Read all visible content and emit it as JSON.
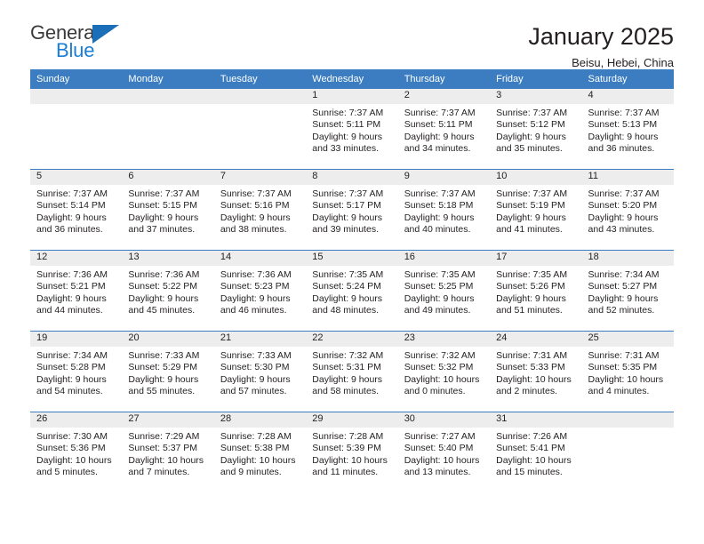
{
  "brand": {
    "name_part1": "General",
    "name_part2": "Blue",
    "triangle_icon": "triangle-icon",
    "primary_color": "#1a7fd4",
    "header_color": "#3b7dc0"
  },
  "header": {
    "title": "January 2025",
    "subtitle": "Beisu, Hebei, China"
  },
  "calendar": {
    "weekday_headers": [
      "Sunday",
      "Monday",
      "Tuesday",
      "Wednesday",
      "Thursday",
      "Friday",
      "Saturday"
    ],
    "weeks": [
      [
        {
          "day": "",
          "empty": true
        },
        {
          "day": "",
          "empty": true
        },
        {
          "day": "",
          "empty": true
        },
        {
          "day": "1",
          "sunrise": "Sunrise: 7:37 AM",
          "sunset": "Sunset: 5:11 PM",
          "daylight_line1": "Daylight: 9 hours",
          "daylight_line2": "and 33 minutes."
        },
        {
          "day": "2",
          "sunrise": "Sunrise: 7:37 AM",
          "sunset": "Sunset: 5:11 PM",
          "daylight_line1": "Daylight: 9 hours",
          "daylight_line2": "and 34 minutes."
        },
        {
          "day": "3",
          "sunrise": "Sunrise: 7:37 AM",
          "sunset": "Sunset: 5:12 PM",
          "daylight_line1": "Daylight: 9 hours",
          "daylight_line2": "and 35 minutes."
        },
        {
          "day": "4",
          "sunrise": "Sunrise: 7:37 AM",
          "sunset": "Sunset: 5:13 PM",
          "daylight_line1": "Daylight: 9 hours",
          "daylight_line2": "and 36 minutes."
        }
      ],
      [
        {
          "day": "5",
          "sunrise": "Sunrise: 7:37 AM",
          "sunset": "Sunset: 5:14 PM",
          "daylight_line1": "Daylight: 9 hours",
          "daylight_line2": "and 36 minutes."
        },
        {
          "day": "6",
          "sunrise": "Sunrise: 7:37 AM",
          "sunset": "Sunset: 5:15 PM",
          "daylight_line1": "Daylight: 9 hours",
          "daylight_line2": "and 37 minutes."
        },
        {
          "day": "7",
          "sunrise": "Sunrise: 7:37 AM",
          "sunset": "Sunset: 5:16 PM",
          "daylight_line1": "Daylight: 9 hours",
          "daylight_line2": "and 38 minutes."
        },
        {
          "day": "8",
          "sunrise": "Sunrise: 7:37 AM",
          "sunset": "Sunset: 5:17 PM",
          "daylight_line1": "Daylight: 9 hours",
          "daylight_line2": "and 39 minutes."
        },
        {
          "day": "9",
          "sunrise": "Sunrise: 7:37 AM",
          "sunset": "Sunset: 5:18 PM",
          "daylight_line1": "Daylight: 9 hours",
          "daylight_line2": "and 40 minutes."
        },
        {
          "day": "10",
          "sunrise": "Sunrise: 7:37 AM",
          "sunset": "Sunset: 5:19 PM",
          "daylight_line1": "Daylight: 9 hours",
          "daylight_line2": "and 41 minutes."
        },
        {
          "day": "11",
          "sunrise": "Sunrise: 7:37 AM",
          "sunset": "Sunset: 5:20 PM",
          "daylight_line1": "Daylight: 9 hours",
          "daylight_line2": "and 43 minutes."
        }
      ],
      [
        {
          "day": "12",
          "sunrise": "Sunrise: 7:36 AM",
          "sunset": "Sunset: 5:21 PM",
          "daylight_line1": "Daylight: 9 hours",
          "daylight_line2": "and 44 minutes."
        },
        {
          "day": "13",
          "sunrise": "Sunrise: 7:36 AM",
          "sunset": "Sunset: 5:22 PM",
          "daylight_line1": "Daylight: 9 hours",
          "daylight_line2": "and 45 minutes."
        },
        {
          "day": "14",
          "sunrise": "Sunrise: 7:36 AM",
          "sunset": "Sunset: 5:23 PM",
          "daylight_line1": "Daylight: 9 hours",
          "daylight_line2": "and 46 minutes."
        },
        {
          "day": "15",
          "sunrise": "Sunrise: 7:35 AM",
          "sunset": "Sunset: 5:24 PM",
          "daylight_line1": "Daylight: 9 hours",
          "daylight_line2": "and 48 minutes."
        },
        {
          "day": "16",
          "sunrise": "Sunrise: 7:35 AM",
          "sunset": "Sunset: 5:25 PM",
          "daylight_line1": "Daylight: 9 hours",
          "daylight_line2": "and 49 minutes."
        },
        {
          "day": "17",
          "sunrise": "Sunrise: 7:35 AM",
          "sunset": "Sunset: 5:26 PM",
          "daylight_line1": "Daylight: 9 hours",
          "daylight_line2": "and 51 minutes."
        },
        {
          "day": "18",
          "sunrise": "Sunrise: 7:34 AM",
          "sunset": "Sunset: 5:27 PM",
          "daylight_line1": "Daylight: 9 hours",
          "daylight_line2": "and 52 minutes."
        }
      ],
      [
        {
          "day": "19",
          "sunrise": "Sunrise: 7:34 AM",
          "sunset": "Sunset: 5:28 PM",
          "daylight_line1": "Daylight: 9 hours",
          "daylight_line2": "and 54 minutes."
        },
        {
          "day": "20",
          "sunrise": "Sunrise: 7:33 AM",
          "sunset": "Sunset: 5:29 PM",
          "daylight_line1": "Daylight: 9 hours",
          "daylight_line2": "and 55 minutes."
        },
        {
          "day": "21",
          "sunrise": "Sunrise: 7:33 AM",
          "sunset": "Sunset: 5:30 PM",
          "daylight_line1": "Daylight: 9 hours",
          "daylight_line2": "and 57 minutes."
        },
        {
          "day": "22",
          "sunrise": "Sunrise: 7:32 AM",
          "sunset": "Sunset: 5:31 PM",
          "daylight_line1": "Daylight: 9 hours",
          "daylight_line2": "and 58 minutes."
        },
        {
          "day": "23",
          "sunrise": "Sunrise: 7:32 AM",
          "sunset": "Sunset: 5:32 PM",
          "daylight_line1": "Daylight: 10 hours",
          "daylight_line2": "and 0 minutes."
        },
        {
          "day": "24",
          "sunrise": "Sunrise: 7:31 AM",
          "sunset": "Sunset: 5:33 PM",
          "daylight_line1": "Daylight: 10 hours",
          "daylight_line2": "and 2 minutes."
        },
        {
          "day": "25",
          "sunrise": "Sunrise: 7:31 AM",
          "sunset": "Sunset: 5:35 PM",
          "daylight_line1": "Daylight: 10 hours",
          "daylight_line2": "and 4 minutes."
        }
      ],
      [
        {
          "day": "26",
          "sunrise": "Sunrise: 7:30 AM",
          "sunset": "Sunset: 5:36 PM",
          "daylight_line1": "Daylight: 10 hours",
          "daylight_line2": "and 5 minutes."
        },
        {
          "day": "27",
          "sunrise": "Sunrise: 7:29 AM",
          "sunset": "Sunset: 5:37 PM",
          "daylight_line1": "Daylight: 10 hours",
          "daylight_line2": "and 7 minutes."
        },
        {
          "day": "28",
          "sunrise": "Sunrise: 7:28 AM",
          "sunset": "Sunset: 5:38 PM",
          "daylight_line1": "Daylight: 10 hours",
          "daylight_line2": "and 9 minutes."
        },
        {
          "day": "29",
          "sunrise": "Sunrise: 7:28 AM",
          "sunset": "Sunset: 5:39 PM",
          "daylight_line1": "Daylight: 10 hours",
          "daylight_line2": "and 11 minutes."
        },
        {
          "day": "30",
          "sunrise": "Sunrise: 7:27 AM",
          "sunset": "Sunset: 5:40 PM",
          "daylight_line1": "Daylight: 10 hours",
          "daylight_line2": "and 13 minutes."
        },
        {
          "day": "31",
          "sunrise": "Sunrise: 7:26 AM",
          "sunset": "Sunset: 5:41 PM",
          "daylight_line1": "Daylight: 10 hours",
          "daylight_line2": "and 15 minutes."
        },
        {
          "day": "",
          "empty": true
        }
      ]
    ]
  }
}
